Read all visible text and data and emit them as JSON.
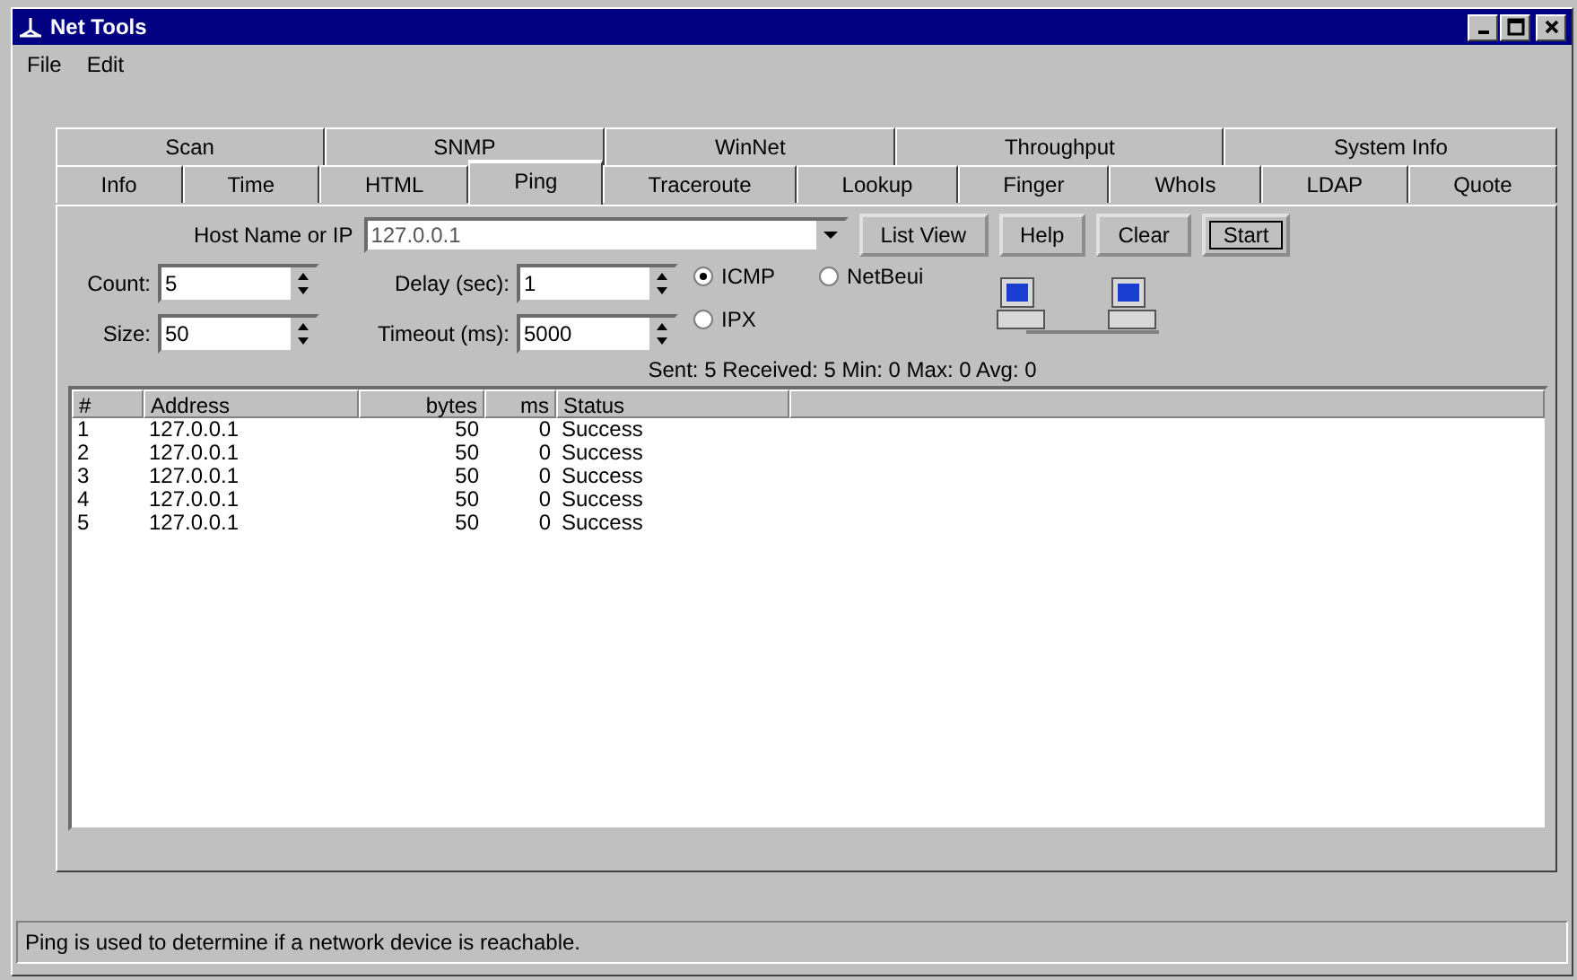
{
  "window": {
    "title": "Net Tools"
  },
  "menu": [
    "File",
    "Edit"
  ],
  "tab_rows": [
    [
      {
        "label": "Scan",
        "selected": false
      },
      {
        "label": "SNMP",
        "selected": false
      },
      {
        "label": "WinNet",
        "selected": false
      },
      {
        "label": "Throughput",
        "selected": false
      },
      {
        "label": "System Info",
        "selected": false
      }
    ],
    [
      {
        "label": "Info",
        "selected": false
      },
      {
        "label": "Time",
        "selected": false
      },
      {
        "label": "HTML",
        "selected": false
      },
      {
        "label": "Ping",
        "selected": true
      },
      {
        "label": "Traceroute",
        "selected": false
      },
      {
        "label": "Lookup",
        "selected": false
      },
      {
        "label": "Finger",
        "selected": false
      },
      {
        "label": "WhoIs",
        "selected": false
      },
      {
        "label": "LDAP",
        "selected": false
      },
      {
        "label": "Quote",
        "selected": false
      }
    ]
  ],
  "host": {
    "label": "Host Name or IP",
    "value": "127.0.0.1"
  },
  "buttons": [
    {
      "label": "List View",
      "default": false
    },
    {
      "label": "Help",
      "default": false
    },
    {
      "label": "Clear",
      "default": false
    },
    {
      "label": "Start",
      "default": true
    }
  ],
  "spinners": [
    {
      "label": "Count:",
      "value": "5"
    },
    {
      "label": "Delay (sec):",
      "value": "1"
    },
    {
      "label": "Size:",
      "value": "50"
    },
    {
      "label": "Timeout (ms):",
      "value": "5000"
    }
  ],
  "protocols": [
    {
      "label": "ICMP",
      "selected": true
    },
    {
      "label": "NetBeui",
      "selected": false
    },
    {
      "label": "IPX",
      "selected": false
    }
  ],
  "summary": "Sent: 5 Received: 5  Min: 0 Max: 0 Avg: 0",
  "table": {
    "columns": [
      "#",
      "Address",
      "bytes",
      "ms",
      "Status"
    ],
    "rows": [
      [
        "1",
        "127.0.0.1",
        "50",
        "0",
        "Success"
      ],
      [
        "2",
        "127.0.0.1",
        "50",
        "0",
        "Success"
      ],
      [
        "3",
        "127.0.0.1",
        "50",
        "0",
        "Success"
      ],
      [
        "4",
        "127.0.0.1",
        "50",
        "0",
        "Success"
      ],
      [
        "5",
        "127.0.0.1",
        "50",
        "0",
        "Success"
      ]
    ]
  },
  "status_bar": "Ping is used to determine if a network device is reachable."
}
